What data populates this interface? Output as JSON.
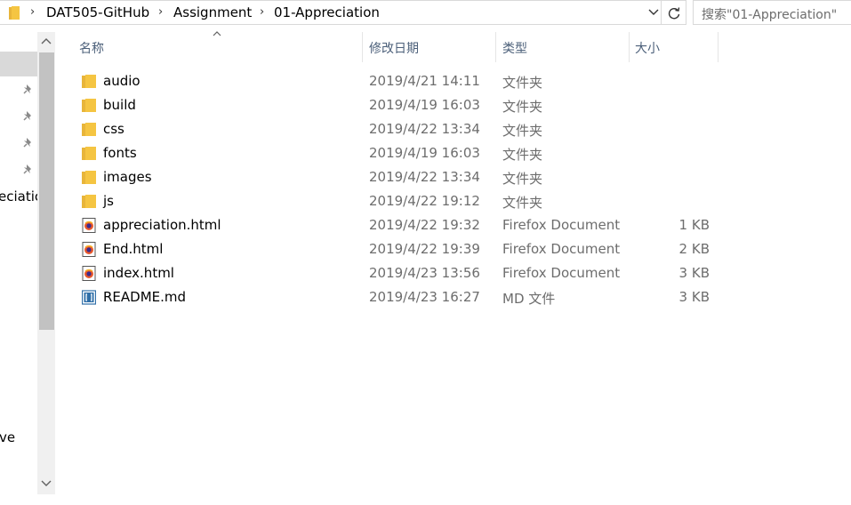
{
  "address_bar": {
    "breadcrumb": [
      "DAT505-GitHub",
      "Assignment",
      "01-Appreciation"
    ]
  },
  "search": {
    "placeholder": "搜索\"01-Appreciation\""
  },
  "nav_pane": {
    "partial_labels": [
      "eciatic",
      "ve"
    ]
  },
  "columns": {
    "name": "名称",
    "date": "修改日期",
    "type": "类型",
    "size": "大小"
  },
  "files": [
    {
      "name": "audio",
      "date": "2019/4/21 14:11",
      "type": "文件夹",
      "size": "",
      "icon": "folder-icon"
    },
    {
      "name": "build",
      "date": "2019/4/19 16:03",
      "type": "文件夹",
      "size": "",
      "icon": "folder-icon"
    },
    {
      "name": "css",
      "date": "2019/4/22 13:34",
      "type": "文件夹",
      "size": "",
      "icon": "folder-icon"
    },
    {
      "name": "fonts",
      "date": "2019/4/19 16:03",
      "type": "文件夹",
      "size": "",
      "icon": "folder-icon"
    },
    {
      "name": "images",
      "date": "2019/4/22 13:34",
      "type": "文件夹",
      "size": "",
      "icon": "folder-icon"
    },
    {
      "name": "js",
      "date": "2019/4/22 19:12",
      "type": "文件夹",
      "size": "",
      "icon": "folder-icon"
    },
    {
      "name": "appreciation.html",
      "date": "2019/4/22 19:32",
      "type": "Firefox Document",
      "size": "1 KB",
      "icon": "firefox-document-icon"
    },
    {
      "name": "End.html",
      "date": "2019/4/22 19:39",
      "type": "Firefox Document",
      "size": "2 KB",
      "icon": "firefox-document-icon"
    },
    {
      "name": "index.html",
      "date": "2019/4/23 13:56",
      "type": "Firefox Document",
      "size": "3 KB",
      "icon": "firefox-document-icon"
    },
    {
      "name": "README.md",
      "date": "2019/4/23 16:27",
      "type": "MD 文件",
      "size": "3 KB",
      "icon": "md-file-icon"
    }
  ],
  "colors": {
    "folder": "#f5c542",
    "header_text": "#4c607a",
    "detail_text": "#6d6d6d",
    "selection": "#d9d9d9",
    "scrollbar_thumb": "#c2c2c2"
  }
}
